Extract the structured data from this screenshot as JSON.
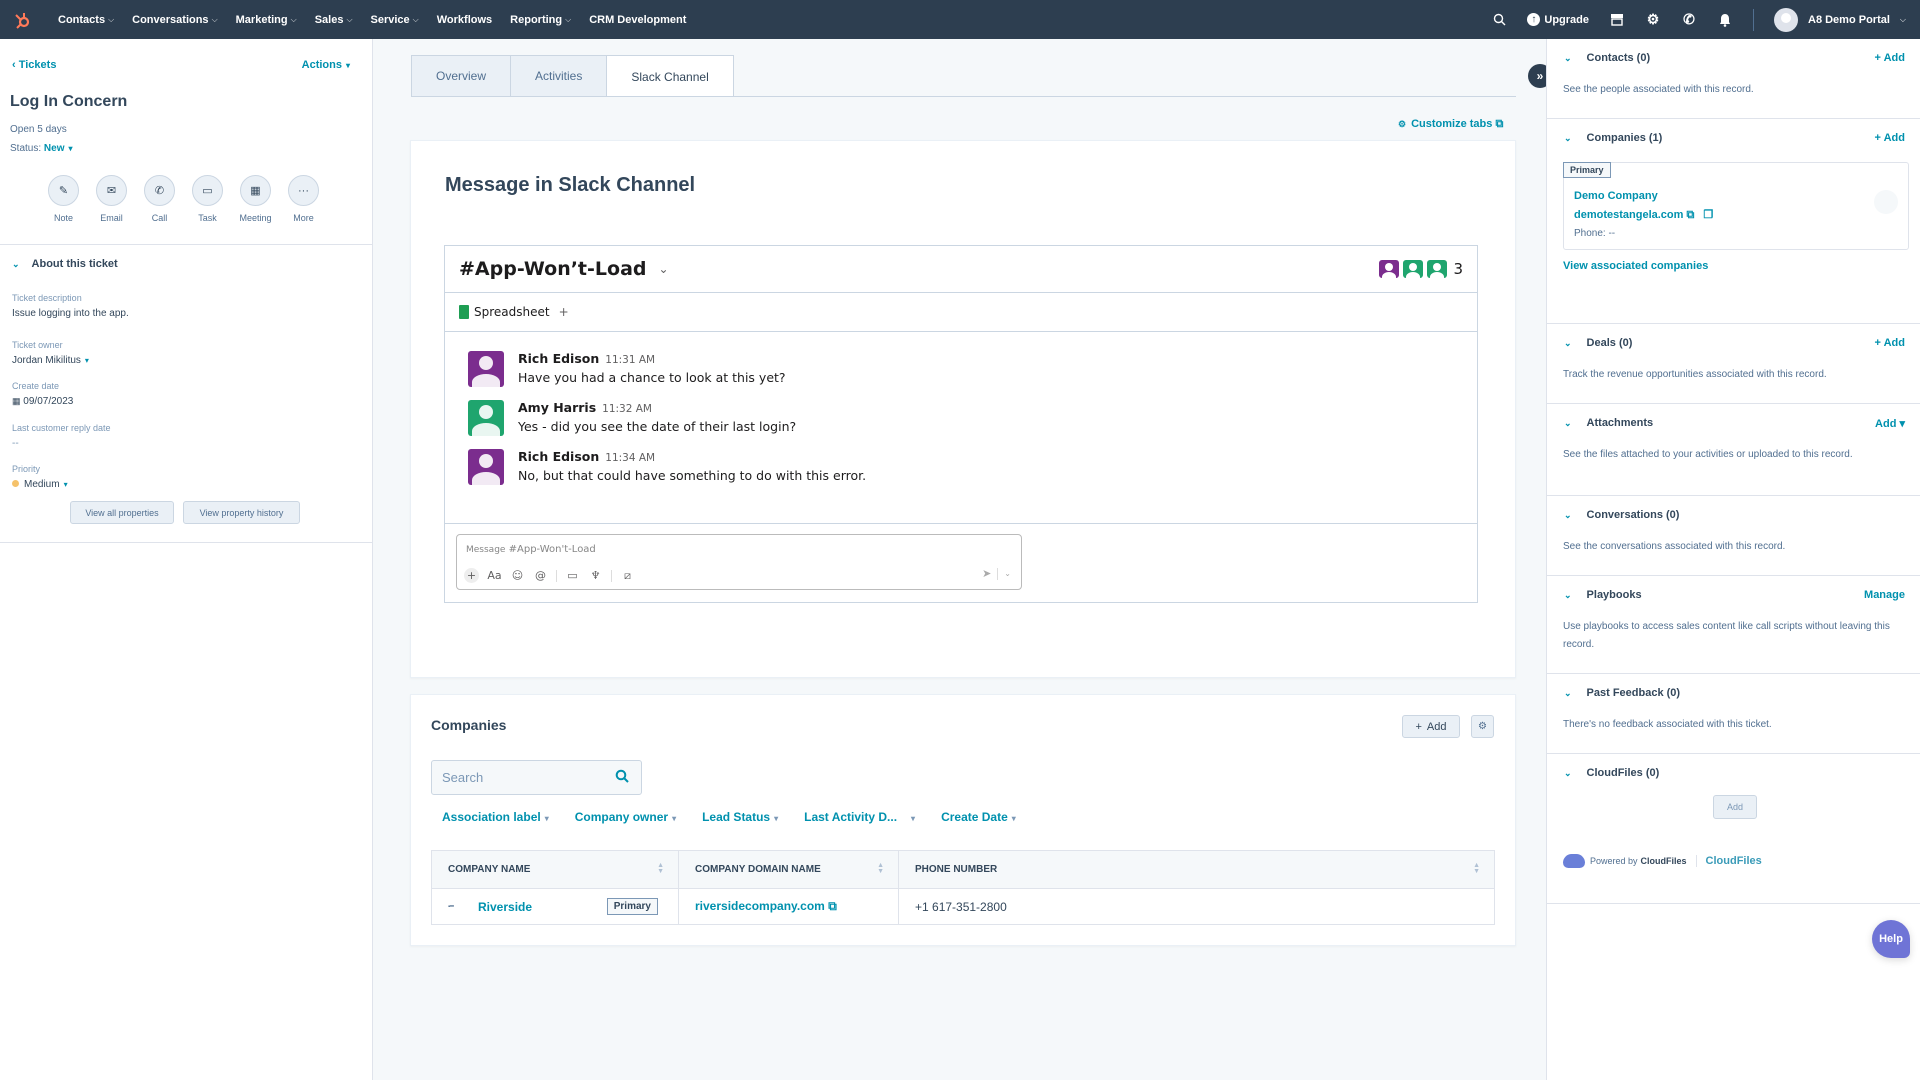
{
  "topnav": {
    "items": [
      {
        "label": "Contacts",
        "dropdown": true
      },
      {
        "label": "Conversations",
        "dropdown": true
      },
      {
        "label": "Marketing",
        "dropdown": true
      },
      {
        "label": "Sales",
        "dropdown": true
      },
      {
        "label": "Service",
        "dropdown": true
      },
      {
        "label": "Workflows",
        "dropdown": false
      },
      {
        "label": "Reporting",
        "dropdown": true
      },
      {
        "label": "CRM Development",
        "dropdown": false
      }
    ],
    "upgrade_label": "Upgrade",
    "account_name": "A8 Demo Portal",
    "icons": [
      "search-icon",
      "upgrade-icon",
      "marketplace-icon",
      "settings-icon",
      "calling-icon",
      "notifications-icon"
    ]
  },
  "left": {
    "breadcrumb": "Tickets",
    "actions_label": "Actions",
    "title": "Log In Concern",
    "open_duration": "Open 5 days",
    "status_label": "Status:",
    "status_value": "New",
    "action_buttons": [
      {
        "label": "Note",
        "icon": "✎"
      },
      {
        "label": "Email",
        "icon": "✉"
      },
      {
        "label": "Call",
        "icon": "✆"
      },
      {
        "label": "Task",
        "icon": "▭"
      },
      {
        "label": "Meeting",
        "icon": "▦"
      },
      {
        "label": "More",
        "icon": "···"
      }
    ],
    "about_heading": "About this ticket",
    "properties": {
      "description_label": "Ticket description",
      "description_value": "Issue logging into the app.",
      "owner_label": "Ticket owner",
      "owner_value": "Jordan Mikilitus",
      "create_date_label": "Create date",
      "create_date_value": "09/07/2023",
      "last_reply_label": "Last customer reply date",
      "last_reply_value": "--",
      "priority_label": "Priority",
      "priority_value": "Medium",
      "priority_color": "#f5c26b"
    },
    "view_all_label": "View all properties",
    "view_history_label": "View property history"
  },
  "main": {
    "tabs": [
      {
        "label": "Overview",
        "active": false
      },
      {
        "label": "Activities",
        "active": false
      },
      {
        "label": "Slack Channel",
        "active": true
      }
    ],
    "customize_tabs_label": "Customize tabs",
    "slack_card_title": "Message in Slack Channel",
    "slack": {
      "channel": "#App-Won’t-Load",
      "member_count": "3",
      "member_colors": [
        "#7b2d8e",
        "#1fa56e",
        "#1fa56e"
      ],
      "bookmark_label": "Spreadsheet",
      "messages": [
        {
          "author": "Rich Edison",
          "time": "11:31 AM",
          "text": "Have you had a chance to look at this yet?",
          "color": "#7b2d8e"
        },
        {
          "author": "Amy Harris",
          "time": "11:32 AM",
          "text": "Yes - did you see the date of their last login?",
          "color": "#1fa56e"
        },
        {
          "author": "Rich Edison",
          "time": "11:34 AM",
          "text": "No, but that could have something to do with this error.",
          "color": "#7b2d8e"
        }
      ],
      "composer_label": "Message",
      "composer_placeholder": "#App-Won't-Load"
    },
    "companies": {
      "title": "Companies",
      "add_label": "Add",
      "search_placeholder": "Search",
      "filters": [
        "Association label",
        "Company owner",
        "Lead Status",
        "Last Activity D...",
        "Create Date"
      ],
      "columns": [
        "COMPANY NAME",
        "COMPANY DOMAIN NAME",
        "PHONE NUMBER"
      ],
      "rows": [
        {
          "name": "Riverside",
          "badge": "Primary",
          "domain": "riversidecompany.com",
          "phone": "+1 617-351-2800"
        }
      ]
    }
  },
  "right": {
    "sections": [
      {
        "title": "Contacts (0)",
        "action": "+ Add",
        "desc": "See the people associated with this record."
      },
      {
        "title": "Companies (1)",
        "action": "+ Add"
      },
      {
        "title": "Deals (0)",
        "action": "+ Add",
        "desc": "Track the revenue opportunities associated with this record."
      },
      {
        "title": "Attachments",
        "action": "Add ▾",
        "desc": "See the files attached to your activities or uploaded to this record."
      },
      {
        "title": "Conversations (0)",
        "action": "",
        "desc": "See the conversations associated with this record."
      },
      {
        "title": "Playbooks",
        "action": "Manage",
        "desc": "Use playbooks to access sales content like call scripts without leaving this record."
      },
      {
        "title": "Past Feedback (0)",
        "action": "",
        "desc": "There's no feedback associated with this ticket."
      },
      {
        "title": "CloudFiles (0)",
        "action": ""
      }
    ],
    "company_card": {
      "badge": "Primary",
      "name": "Demo Company",
      "domain": "demotestangela.com",
      "phone": "Phone: --"
    },
    "view_associated_label": "View associated companies",
    "cloudfiles_add_label": "Add",
    "powered_by_text": "Powered by",
    "powered_by_brand": "CloudFiles",
    "cloudfiles_link": "CloudFiles"
  },
  "help_label": "Help"
}
